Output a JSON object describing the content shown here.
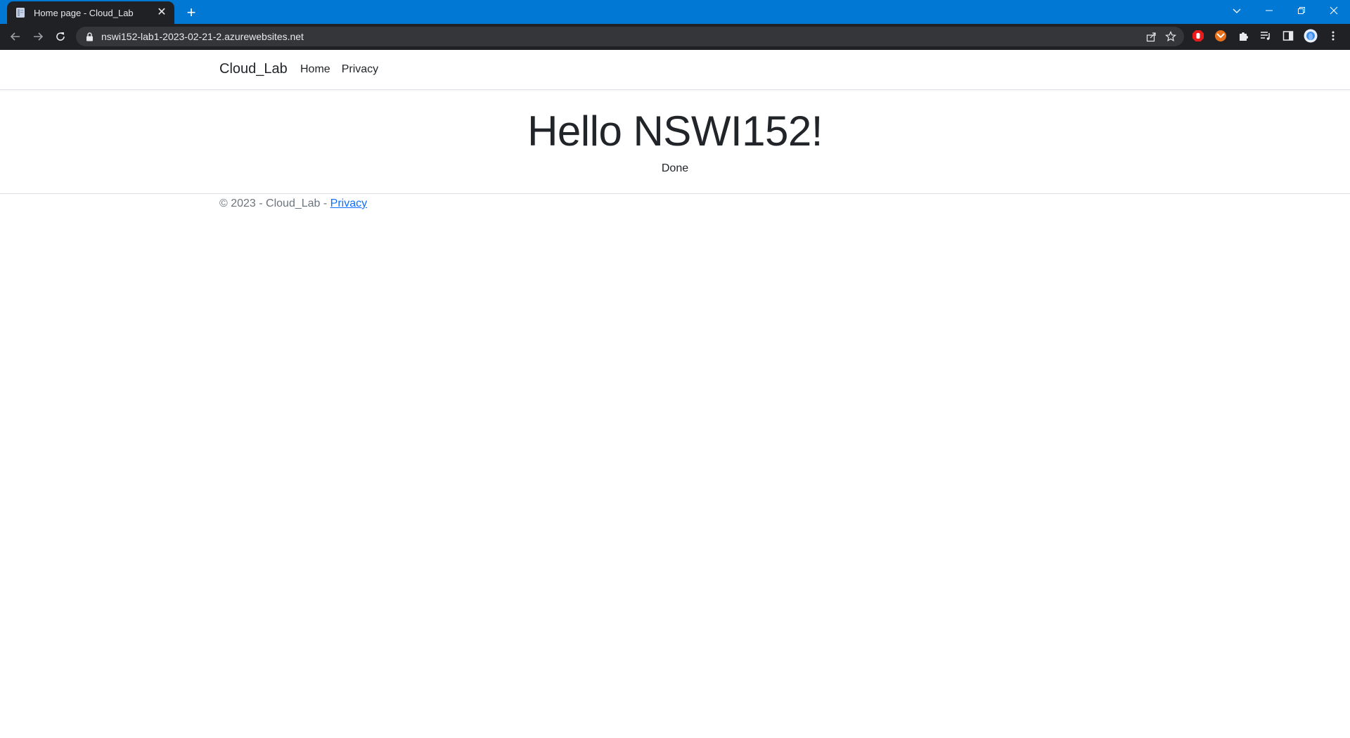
{
  "browser": {
    "tab": {
      "title": "Home page - Cloud_Lab",
      "favicon": "document-icon"
    },
    "new_tab": "+",
    "url": "nswi152-lab1-2023-02-21-2.azurewebsites.net",
    "accent": "#0078d4"
  },
  "site": {
    "brand": "Cloud_Lab",
    "nav": [
      {
        "label": "Home"
      },
      {
        "label": "Privacy"
      }
    ],
    "heading": "Hello NSWI152!",
    "status": "Done",
    "footer": {
      "copyright": "© 2023 - Cloud_Lab - ",
      "link": "Privacy"
    }
  }
}
